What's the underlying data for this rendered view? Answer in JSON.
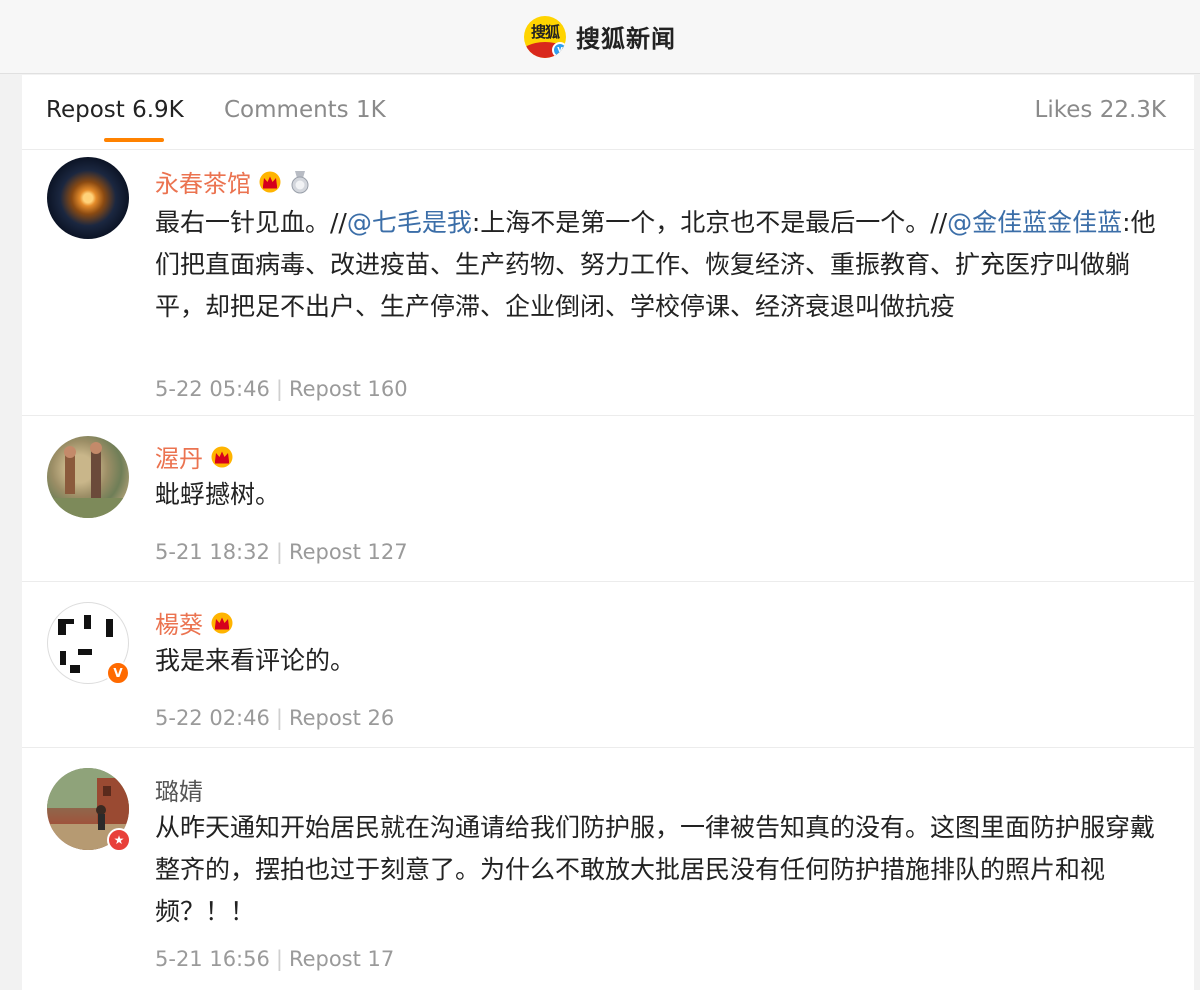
{
  "header": {
    "logo_text": "搜狐",
    "brand_name": "搜狐新闻"
  },
  "tabs": {
    "repost": "Repost 6.9K",
    "comments": "Comments 1K",
    "likes": "Likes 22.3K"
  },
  "reposts": [
    {
      "username": "永春茶馆",
      "text_parts": [
        {
          "t": "最右一针见血。//",
          "mention": false
        },
        {
          "t": "@七毛是我",
          "mention": true
        },
        {
          "t": ":上海不是第一个，北京也不是最后一个。//",
          "mention": false
        },
        {
          "t": "@金佳蓝金佳蓝",
          "mention": true
        },
        {
          "t": ":他们把直面病毒、改进疫苗、生产药物、努力工作、恢复经济、重振教育、扩充医疗叫做躺平，却把足不出户、生产停滞、企业倒闭、学校停课、经济衰退叫做抗疫",
          "mention": false
        }
      ],
      "time": "5-22 05:46",
      "repost": "Repost 160"
    },
    {
      "username": "渥丹",
      "text": "蚍蜉撼树。",
      "time": "5-21 18:32",
      "repost": "Repost 127"
    },
    {
      "username": "楊葵",
      "text": "我是来看评论的。",
      "time": "5-22 02:46",
      "repost": "Repost 26"
    },
    {
      "username": "璐婧",
      "text": "从昨天通知开始居民就在沟通请给我们防护服，一律被告知真的没有。这图里面防护服穿戴整齐的，摆拍也过于刻意了。为什么不敢放大批居民没有任何防护措施排队的照片和视频？！！",
      "time": "5-21 16:56",
      "repost": "Repost 17"
    }
  ],
  "colors": {
    "accent_orange": "#ff8200",
    "username_orange": "#eb7350",
    "mention_blue": "#3b6ea8"
  }
}
